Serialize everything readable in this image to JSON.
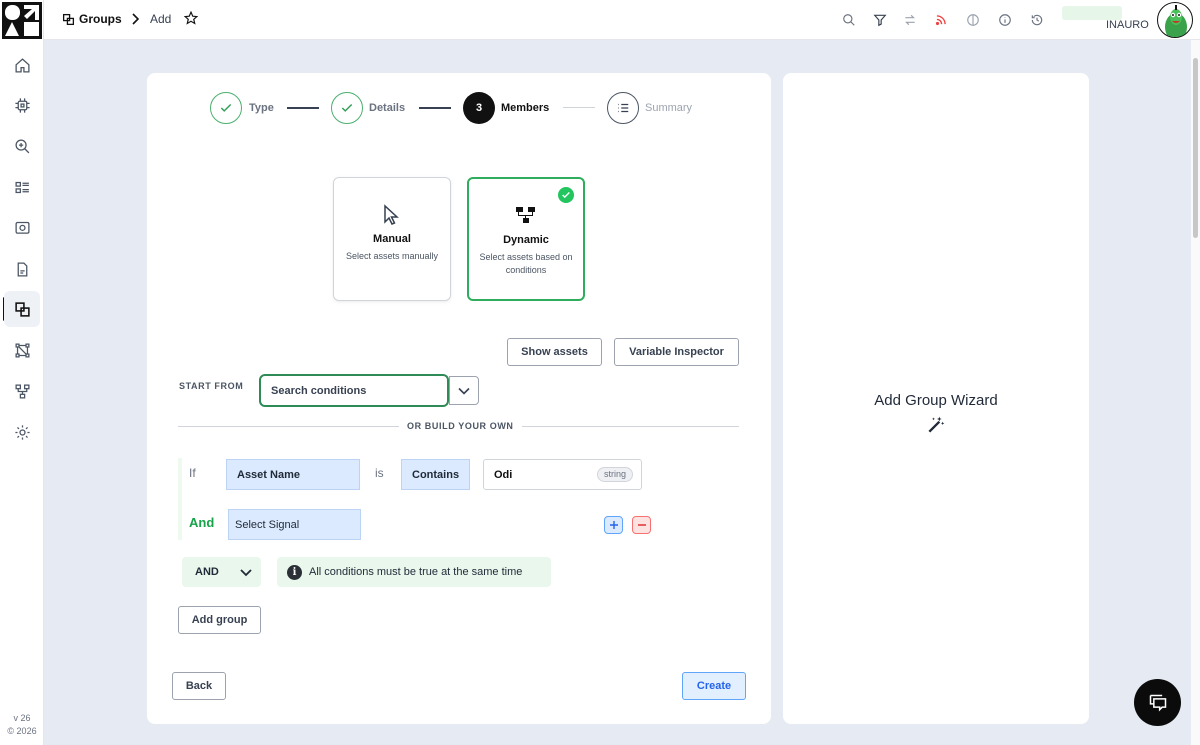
{
  "brand": {
    "logo_icon": "brand-logo-icon"
  },
  "sidebar": {
    "items": [
      {
        "name": "home",
        "icon": "home-icon"
      },
      {
        "name": "devices",
        "icon": "chip-icon"
      },
      {
        "name": "explore",
        "icon": "zoom-search-icon"
      },
      {
        "name": "list",
        "icon": "list-view-icon"
      },
      {
        "name": "assets",
        "icon": "camera-folder-icon"
      },
      {
        "name": "reports",
        "icon": "document-icon"
      },
      {
        "name": "groups",
        "icon": "groups-icon",
        "active": true
      },
      {
        "name": "topology",
        "icon": "network-icon"
      },
      {
        "name": "hierarchy",
        "icon": "hierarchy-icon"
      },
      {
        "name": "settings",
        "icon": "gear-icon"
      }
    ],
    "version": "v 26",
    "copyright": "© 2026"
  },
  "header": {
    "breadcrumb_root": "Groups",
    "breadcrumb_current": "Add",
    "user_name": "INAURO",
    "icons": [
      "search-icon",
      "filter-icon",
      "transfer-icon",
      "rss-icon",
      "contrast-icon",
      "info-icon",
      "history-icon"
    ]
  },
  "stepper": {
    "steps": [
      {
        "label": "Type",
        "state": "done"
      },
      {
        "label": "Details",
        "state": "done"
      },
      {
        "label": "Members",
        "state": "current",
        "number": "3"
      },
      {
        "label": "Summary",
        "state": "todo"
      }
    ]
  },
  "options": {
    "manual": {
      "title": "Manual",
      "desc": "Select assets manually"
    },
    "dynamic": {
      "title": "Dynamic",
      "desc": "Select assets based on conditions",
      "selected": true
    }
  },
  "actions": {
    "show_assets": "Show assets",
    "variable_inspector": "Variable Inspector",
    "add_group": "Add group",
    "back": "Back",
    "create": "Create"
  },
  "conditions": {
    "start_from_label": "START FROM",
    "search_placeholder": "Search conditions",
    "divider_text": "OR BUILD YOUR OWN",
    "if_label": "If",
    "field": "Asset Name",
    "is_label": "is",
    "operator": "Contains",
    "value": "Odi",
    "value_type": "string",
    "and_label": "And",
    "signal_placeholder": "Select Signal",
    "combinator": "AND",
    "info_text": "All conditions must be true at the same time"
  },
  "wizard": {
    "title": "Add Group Wizard"
  },
  "colors": {
    "accent_green": "#2eae5c",
    "create_blue": "#2563eb",
    "remove_red": "#dc2626"
  }
}
